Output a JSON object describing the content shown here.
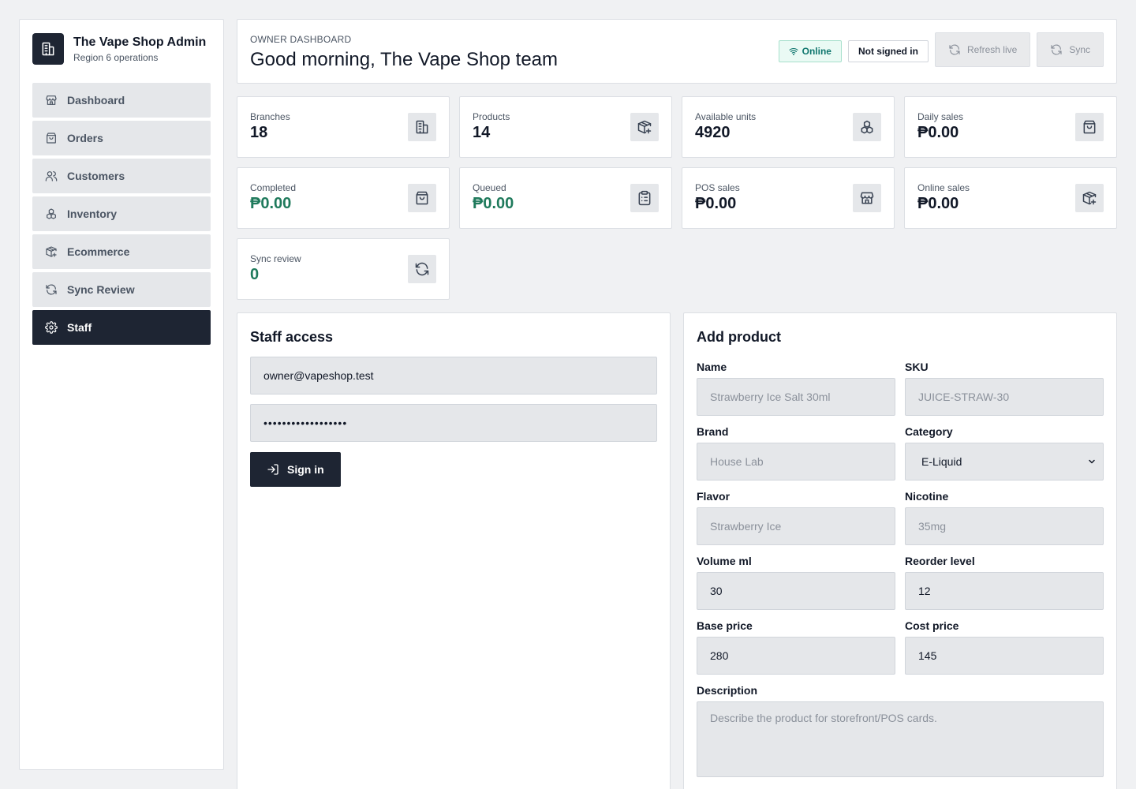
{
  "sidebar": {
    "brand_title": "The Vape Shop Admin",
    "brand_subtitle": "Region 6 operations",
    "items": [
      {
        "label": "Dashboard",
        "icon": "store-icon"
      },
      {
        "label": "Orders",
        "icon": "bag-icon"
      },
      {
        "label": "Customers",
        "icon": "users-icon"
      },
      {
        "label": "Inventory",
        "icon": "boxes-icon"
      },
      {
        "label": "Ecommerce",
        "icon": "package-plus-icon"
      },
      {
        "label": "Sync Review",
        "icon": "refresh-icon"
      },
      {
        "label": "Staff",
        "icon": "gear-icon",
        "active": true
      }
    ]
  },
  "header": {
    "eyebrow": "OWNER DASHBOARD",
    "greeting": "Good morning, The Vape Shop team",
    "online_label": "Online",
    "signed_label": "Not signed in",
    "refresh_label": "Refresh live",
    "sync_label": "Sync"
  },
  "stats": [
    {
      "label": "Branches",
      "value": "18",
      "icon": "building-icon"
    },
    {
      "label": "Products",
      "value": "14",
      "icon": "package-plus-icon"
    },
    {
      "label": "Available units",
      "value": "4920",
      "icon": "boxes-icon"
    },
    {
      "label": "Daily sales",
      "value": "₱0.00",
      "icon": "bag-icon"
    },
    {
      "label": "Completed",
      "value": "₱0.00",
      "icon": "bag-icon",
      "accent": true
    },
    {
      "label": "Queued",
      "value": "₱0.00",
      "icon": "clipboard-icon",
      "accent": true
    },
    {
      "label": "POS sales",
      "value": "₱0.00",
      "icon": "store-icon"
    },
    {
      "label": "Online sales",
      "value": "₱0.00",
      "icon": "package-plus-icon"
    },
    {
      "label": "Sync review",
      "value": "0",
      "icon": "refresh-icon",
      "accent": true
    }
  ],
  "staff": {
    "title": "Staff access",
    "email": "owner@vapeshop.test",
    "password_mask": "••••••••••••••••••",
    "signin_label": "Sign in"
  },
  "product_form": {
    "title": "Add product",
    "name_label": "Name",
    "name_placeholder": "Strawberry Ice Salt 30ml",
    "sku_label": "SKU",
    "sku_placeholder": "JUICE-STRAW-30",
    "brand_label": "Brand",
    "brand_placeholder": "House Lab",
    "category_label": "Category",
    "category_value": "E-Liquid",
    "flavor_label": "Flavor",
    "flavor_placeholder": "Strawberry Ice",
    "nicotine_label": "Nicotine",
    "nicotine_placeholder": "35mg",
    "volume_label": "Volume ml",
    "volume_value": "30",
    "reorder_label": "Reorder level",
    "reorder_value": "12",
    "base_label": "Base price",
    "base_value": "280",
    "cost_label": "Cost price",
    "cost_value": "145",
    "description_label": "Description",
    "description_placeholder": "Describe the product for storefront/POS cards."
  },
  "colors": {
    "primary_dark": "#1e2533",
    "accent_green": "#1f7a5c",
    "background": "#f0f1f3"
  }
}
